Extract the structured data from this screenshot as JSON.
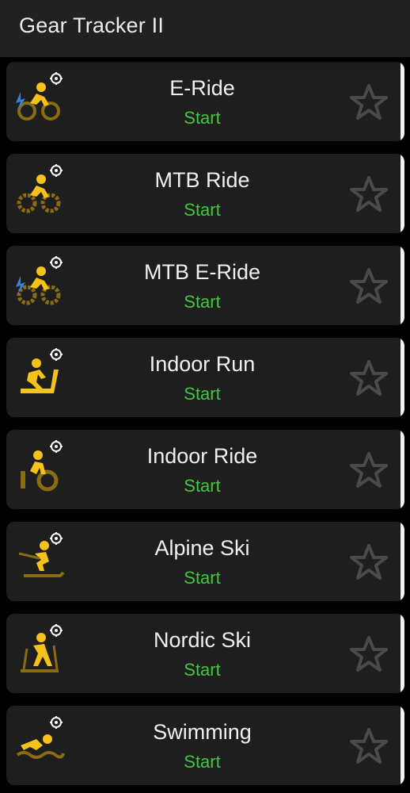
{
  "app": {
    "title": "Gear Tracker II"
  },
  "colors": {
    "accent_yellow": "#f5c21b",
    "gear_brown": "#8a6d12",
    "bolt_blue": "#2f86e8",
    "start_green": "#3fc93f",
    "star_gray": "#4a4a4a"
  },
  "activities": [
    {
      "name": "E-Ride",
      "action": "Start",
      "icon": "ebike-icon"
    },
    {
      "name": "MTB Ride",
      "action": "Start",
      "icon": "mtb-icon"
    },
    {
      "name": "MTB E-Ride",
      "action": "Start",
      "icon": "mtb-ebike-icon"
    },
    {
      "name": "Indoor Run",
      "action": "Start",
      "icon": "treadmill-icon"
    },
    {
      "name": "Indoor Ride",
      "action": "Start",
      "icon": "stationary-bike-icon"
    },
    {
      "name": "Alpine Ski",
      "action": "Start",
      "icon": "alpine-ski-icon"
    },
    {
      "name": "Nordic Ski",
      "action": "Start",
      "icon": "nordic-ski-icon"
    },
    {
      "name": "Swimming",
      "action": "Start",
      "icon": "swimming-icon"
    }
  ]
}
